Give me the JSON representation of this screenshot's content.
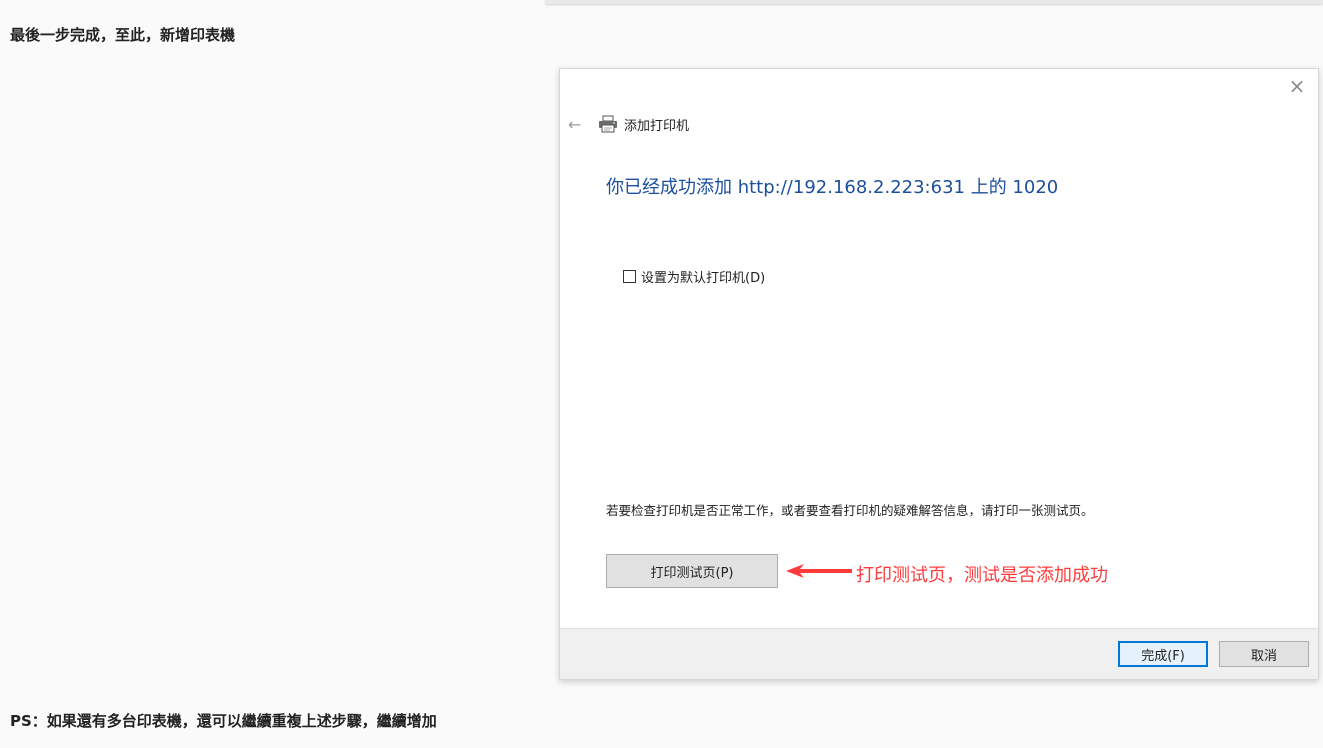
{
  "article": {
    "heading": "最後一步完成，至此，新增印表機",
    "footer": "PS：如果還有多台印表機，還可以繼續重複上述步驟，繼續增加"
  },
  "dialog": {
    "close_symbol": "×",
    "back_symbol": "←",
    "wizard_title": "添加打印机",
    "success_message": "你已经成功添加 http://192.168.2.223:631 上的 1020",
    "default_checkbox_label": "设置为默认打印机(D)",
    "default_checked": false,
    "info_text": "若要检查打印机是否正常工作，或者要查看打印机的疑难解答信息，请打印一张测试页。",
    "print_test_page_label": "打印测试页(P)",
    "finish_label": "完成(F)",
    "cancel_label": "取消"
  },
  "annotation": {
    "text": "打印测试页，测试是否添加成功",
    "color": "#ff3b3b"
  },
  "icons": {
    "back": "back-arrow-icon",
    "printer": "printer-icon",
    "close": "close-icon",
    "annotation": "red-arrow-icon"
  }
}
